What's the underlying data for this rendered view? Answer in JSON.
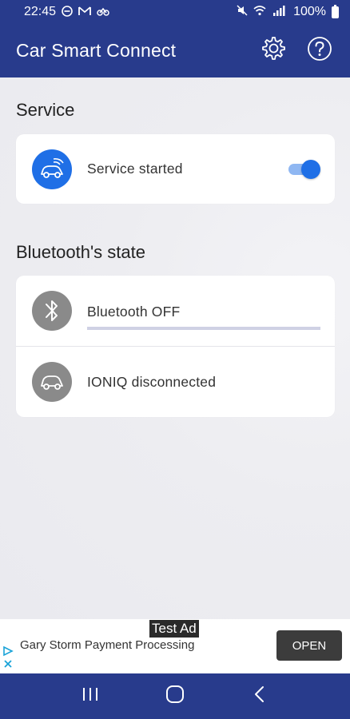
{
  "status_bar": {
    "time": "22:45",
    "battery": "100%"
  },
  "app_bar": {
    "title": "Car Smart Connect",
    "settings_icon": "gear-icon",
    "help_icon": "help-icon"
  },
  "service": {
    "section_title": "Service",
    "status_label": "Service started",
    "toggle_on": true,
    "accent": "#1f6fe6"
  },
  "bluetooth": {
    "section_title": "Bluetooth's state",
    "bluetooth_label": "Bluetooth OFF",
    "car_label": "IONIQ disconnected"
  },
  "ad": {
    "badge": "Test Ad",
    "text": "Gary Storm Payment Processing",
    "button": "OPEN"
  },
  "colors": {
    "primary": "#283b8c",
    "background": "#ededf2"
  }
}
